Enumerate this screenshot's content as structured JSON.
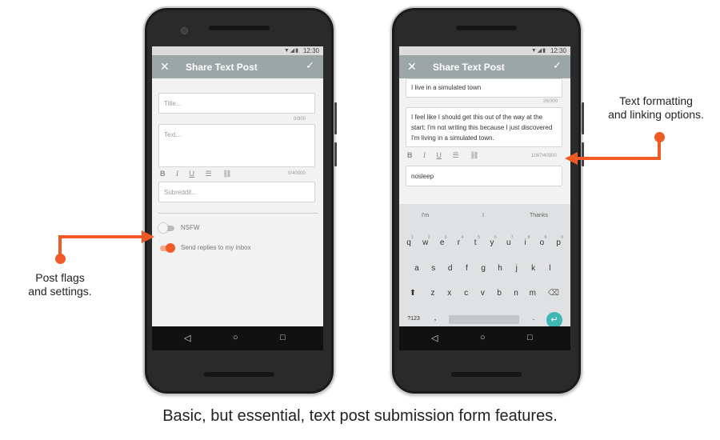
{
  "status_time": "12:30",
  "left_screen": {
    "app_title": "Share Text Post",
    "title_placeholder": "Title...",
    "title_counter": "0/300",
    "text_placeholder": "Text...",
    "text_counter": "0/40000",
    "subreddit_placeholder": "Subreddit...",
    "nsfw_label": "NSFW",
    "nsfw_on": false,
    "replies_label": "Send replies to my inbox",
    "replies_on": true
  },
  "right_screen": {
    "app_title": "Share Text Post",
    "title_value": "I live in a simulated town",
    "title_counter": "26/300",
    "text_value": "I feel like I should get this out of the way at the start: I'm not writing this because I just discovered I'm living in a simulated town.",
    "text_counter": "1087/40000",
    "subreddit_value": "nosleep",
    "suggestions": [
      "I'm",
      "I",
      "Thanks"
    ],
    "row1": [
      "q",
      "w",
      "e",
      "r",
      "t",
      "y",
      "u",
      "i",
      "o",
      "p"
    ],
    "row1_nums": [
      "1",
      "2",
      "3",
      "4",
      "5",
      "6",
      "7",
      "8",
      "9",
      "0"
    ],
    "row2": [
      "a",
      "s",
      "d",
      "f",
      "g",
      "h",
      "j",
      "k",
      "l"
    ],
    "row3": [
      "z",
      "x",
      "c",
      "v",
      "b",
      "n",
      "m"
    ],
    "sym_key": "?123",
    "comma_key": ",",
    "period_key": "."
  },
  "format_icons": [
    "bold-icon",
    "italic-icon",
    "underline-icon",
    "list-icon",
    "link-icon"
  ],
  "callouts": {
    "right_line1": "Text formatting",
    "right_line2": "and linking options.",
    "left_line1": "Post flags",
    "left_line2": "and settings."
  },
  "caption": "Basic, but essential, text post submission form features.",
  "colors": {
    "accent": "#f05a25",
    "appbar": "#9da6a7",
    "enter_key": "#3fb7b2"
  }
}
